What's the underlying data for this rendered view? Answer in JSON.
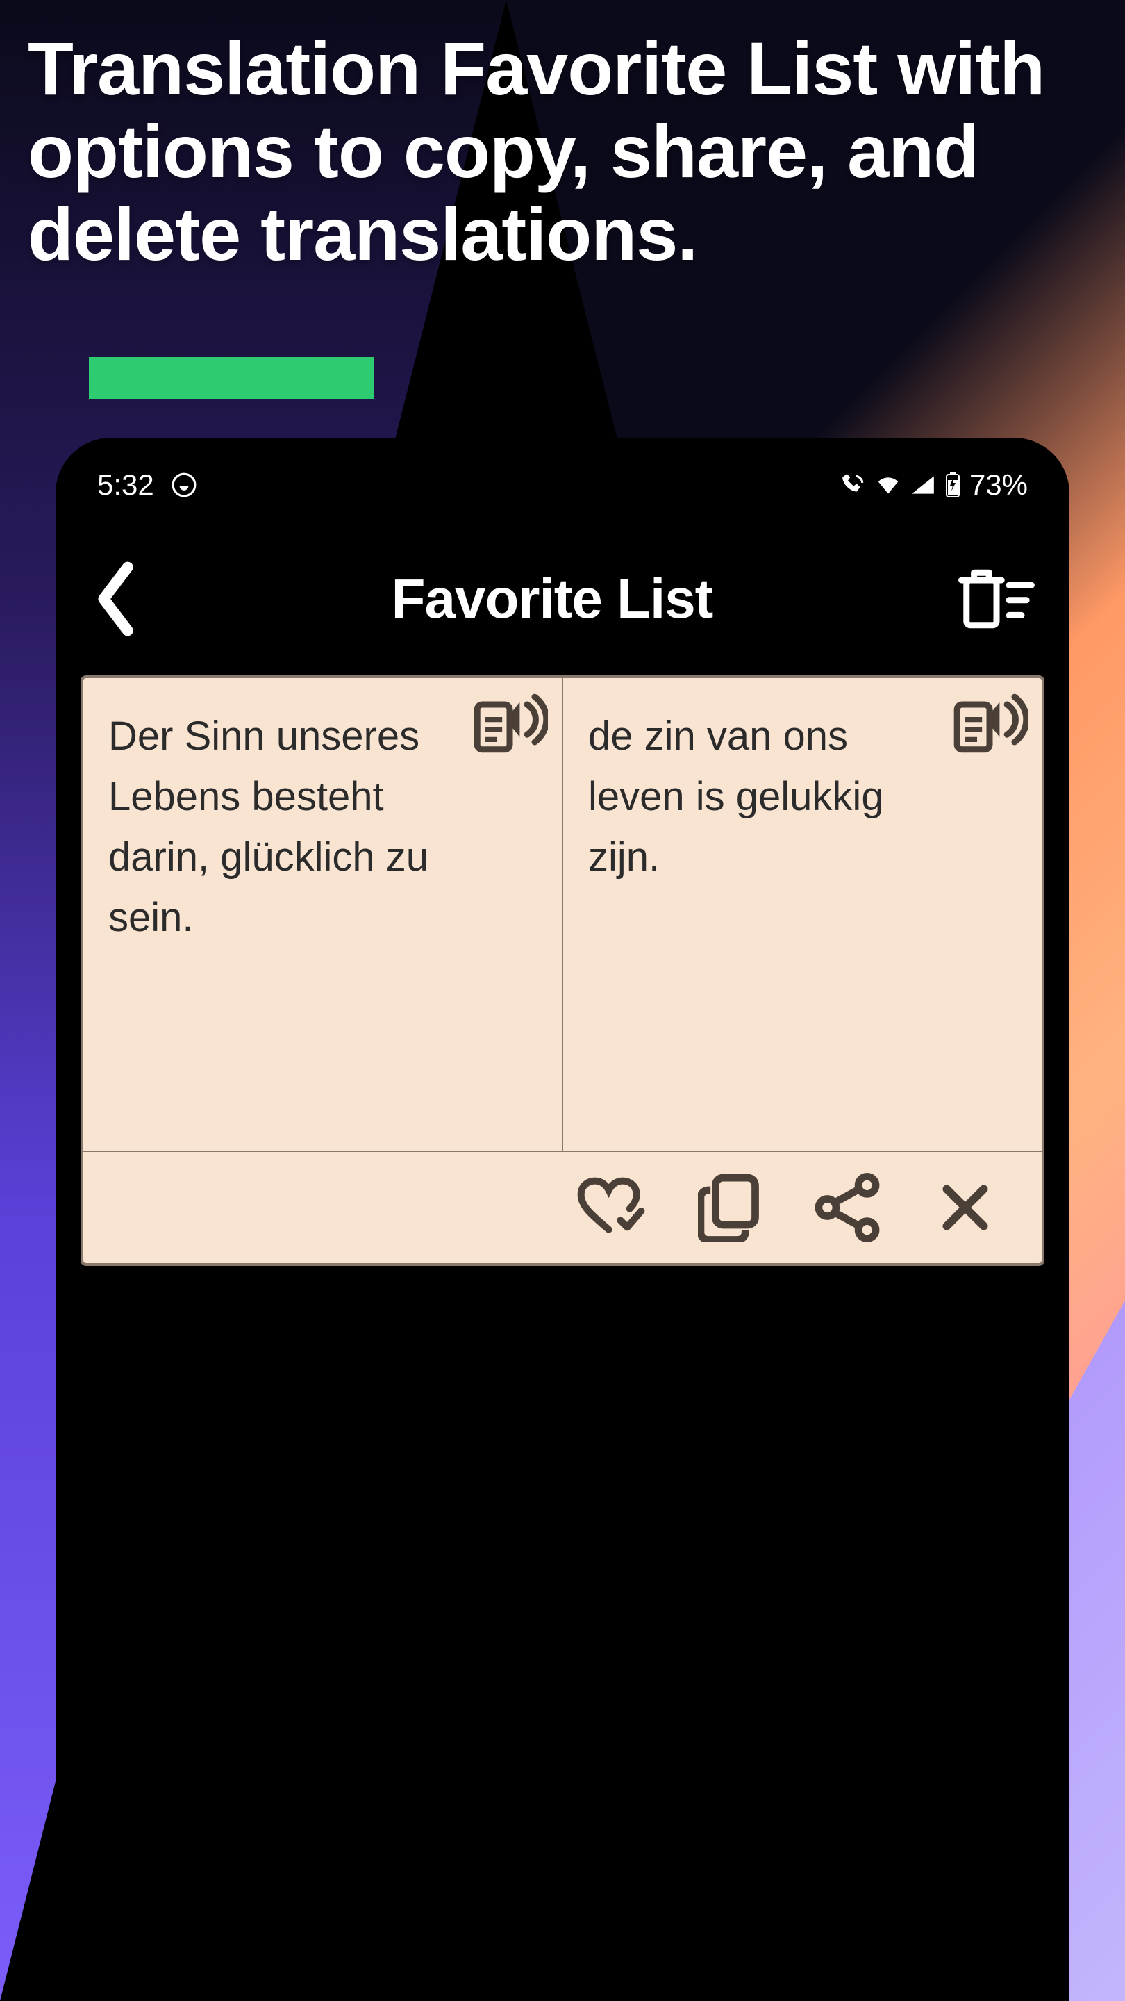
{
  "promo": {
    "heading": "Translation Favorite List with options to copy, share, and delete translations."
  },
  "status": {
    "time": "5:32",
    "battery": "73%"
  },
  "header": {
    "title": "Favorite List"
  },
  "card": {
    "source_text": "Der Sinn unseres Lebens besteht darin, glücklich zu sein.",
    "target_text": "de zin van ons leven is gelukkig zijn."
  }
}
